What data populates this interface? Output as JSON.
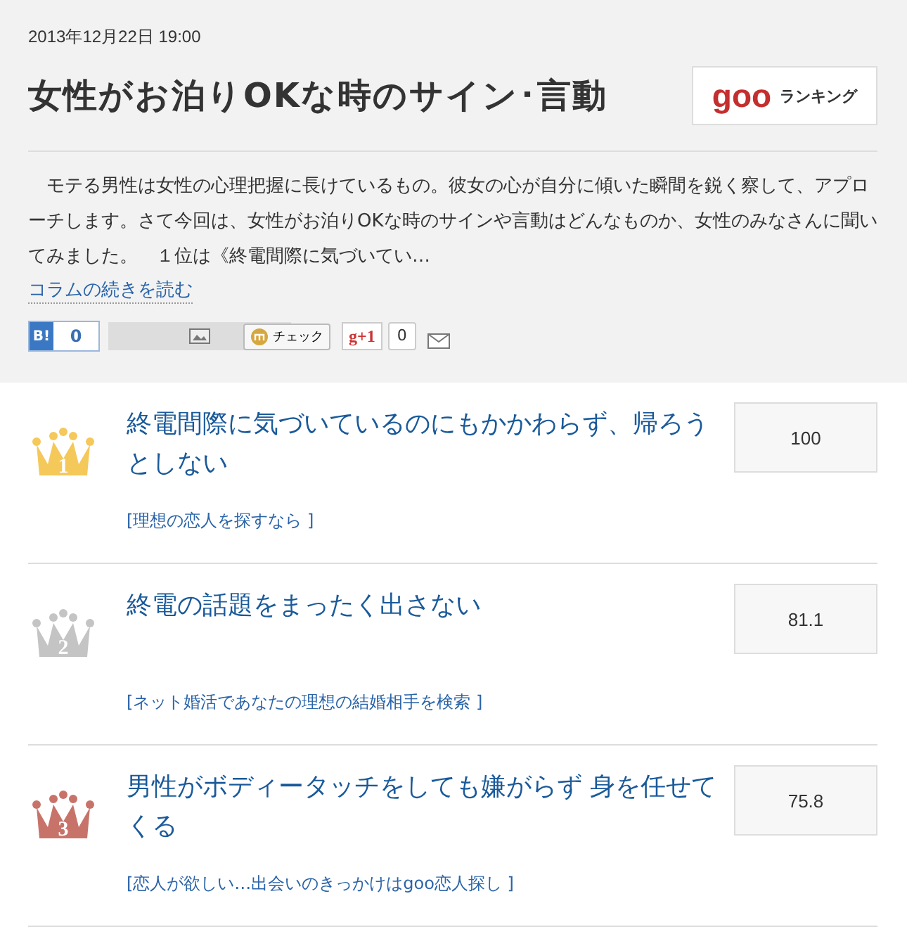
{
  "header": {
    "date": "2013年12月22日 19:00",
    "title": "女性がお泊りOKな時のサイン･言動",
    "logo": {
      "mark": "goo",
      "text": "ランキング"
    },
    "description": "　モテる男性は女性の心理把握に長けているもの。彼女の心が自分に傾いた瞬間を鋭く察して、アプローチします。さて今回は、女性がお泊りOKな時のサインや言動はどんなものか、女性のみなさんに聞いてみました。　１位は《終電間際に気づいてい…",
    "read_more": "コラムの続きを読む"
  },
  "share": {
    "hatena": {
      "label": "B!",
      "count": "0"
    },
    "mixi": {
      "label": "チェック"
    },
    "gplus": {
      "label": "g+1",
      "count": "0"
    }
  },
  "ranking": [
    {
      "rank": "1",
      "color": "#f5c85a",
      "title": "終電間際に気づいているのにもかかわらず、帰ろうとしない",
      "score": "100",
      "link": "[理想の恋人を探すなら ]"
    },
    {
      "rank": "2",
      "color": "#c4c4c4",
      "title": "終電の話題をまったく出さない",
      "score": "81.1",
      "link": "[ネット婚活であなたの理想の結婚相手を検索 ]"
    },
    {
      "rank": "3",
      "color": "#c8736a",
      "title": "男性がボディータッチをしても嫌がらず 身を任せてくる",
      "score": "75.8",
      "link": "[恋人が欲しい…出会いのきっかけはgoo恋人探し ]"
    }
  ]
}
